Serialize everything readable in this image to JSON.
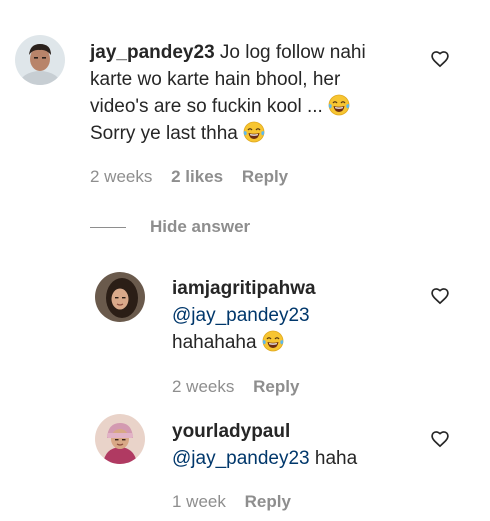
{
  "comments": [
    {
      "username": "jay_pandey23",
      "text": "Jo log follow nahi karte wo karte hain bhool, her video's are so fuckin kool ...",
      "text2": "Sorry ye last thha",
      "time": "2 weeks",
      "likes": "2 likes",
      "reply": "Reply"
    }
  ],
  "hide_answer": "Hide answer",
  "replies": [
    {
      "username": "iamjagritipahwa",
      "mention": "@jay_pandey23",
      "text": "hahahaha",
      "time": "2 weeks",
      "reply": "Reply"
    },
    {
      "username": "yourladypaul",
      "mention": "@jay_pandey23",
      "text": " haha",
      "time": "1 week",
      "reply": "Reply"
    }
  ],
  "icons": {
    "like": "heart-outline-icon",
    "emoji": "tears-of-joy-emoji"
  }
}
